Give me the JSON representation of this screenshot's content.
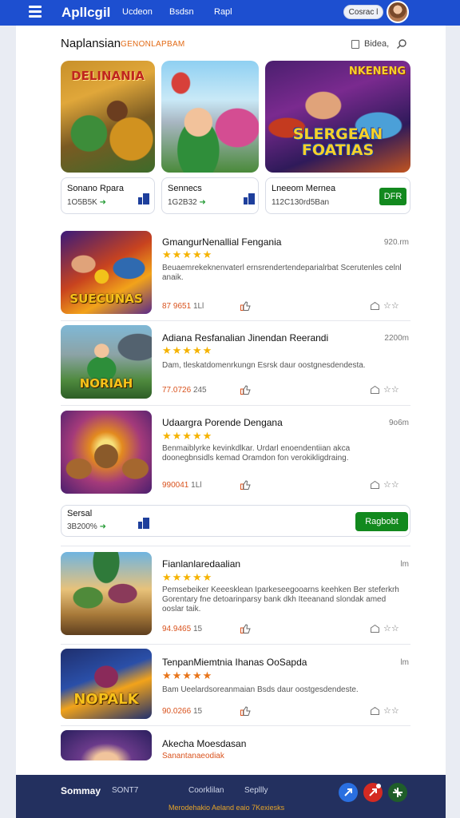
{
  "header": {
    "brand": "Apllcgil",
    "nav": [
      "Ucdeon",
      "Bsdsn",
      "Rapl"
    ],
    "contact_label": "Cosrac l"
  },
  "section": {
    "title": "Naplansian",
    "tag": "GENONLAPBAM",
    "browse_label": "Bidea,"
  },
  "featured": [
    {
      "title": "Sonano Rpara",
      "meta": "1O5B5K",
      "logo": "DELINANIA"
    },
    {
      "title": "Sennecs",
      "meta": "1G2B32",
      "logo": ""
    },
    {
      "title": "Lneeom Mernea",
      "meta": "112C130rd5Ban",
      "logo": "SLERGEAN FOATIAS",
      "logo_top": "NKENENG",
      "button": "DFR"
    }
  ],
  "items": [
    {
      "title": "GmangurNenallial Fengania",
      "size": "920.rm",
      "desc": "Beuaemrekeknenvaterl ernsrendertendeparialrbat Scerutenles celnl anaik.",
      "count": "87 9651",
      "count_suffix": "1Ll",
      "caption": "SUECUNAS"
    },
    {
      "title": "Adiana Resfanalian Jinendan Reerandi",
      "size": "2200m",
      "desc": "Dam, tleskatdomenrkungn Esrsk daur oostgnesdendesta.",
      "count": "77.0726",
      "count_suffix": "245",
      "caption": "NORIAH"
    },
    {
      "title": "Udaargra Porende Dengana",
      "size": "9o6m",
      "desc": "Benmaiblyrke kevinkdlkar. Urdarl enoendentiian akca doonegbnsidls kemad Oramdon fon verokikligdraing.",
      "count": "990041",
      "count_suffix": "1Ll",
      "caption": ""
    },
    {
      "title": "Fianlanlaredaalian",
      "size": "lm",
      "desc": "Pemsebeiker Keeesklean Iparkeseegooarns keehken Ber steferkrh Gorentary fne detoarinparsy bank dkh Iteeanand slondak amed ooslar taik.",
      "count": "94.9465",
      "count_suffix": "15",
      "caption": ""
    },
    {
      "title": "TenpanMiemtnia Ihanas OoSapda",
      "size": "lm",
      "desc": "Bam Ueelardsoreanmaian Bsds daur oostgesdendeste.",
      "count": "90.0266",
      "count_suffix": "15",
      "caption": "NOPALK"
    },
    {
      "title": "Akecha Moesdasan",
      "size": "",
      "desc": "Sanantanaeodiak",
      "count": "",
      "count_suffix": "",
      "caption": ""
    }
  ],
  "promo": {
    "title": "Sersal",
    "meta": "3B200%",
    "button": "Ragbobt"
  },
  "footer": {
    "brand": "Sommay",
    "version": "SONT7",
    "links": [
      "Coorklilan",
      "Sepllly"
    ],
    "copyright": "Merodehakio Aeland eaio 7Kexiesks"
  },
  "colors": {
    "primary": "#1d4fd0",
    "accent_green": "#12891e",
    "star": "#f5b301",
    "footer_bg": "#23305f"
  }
}
